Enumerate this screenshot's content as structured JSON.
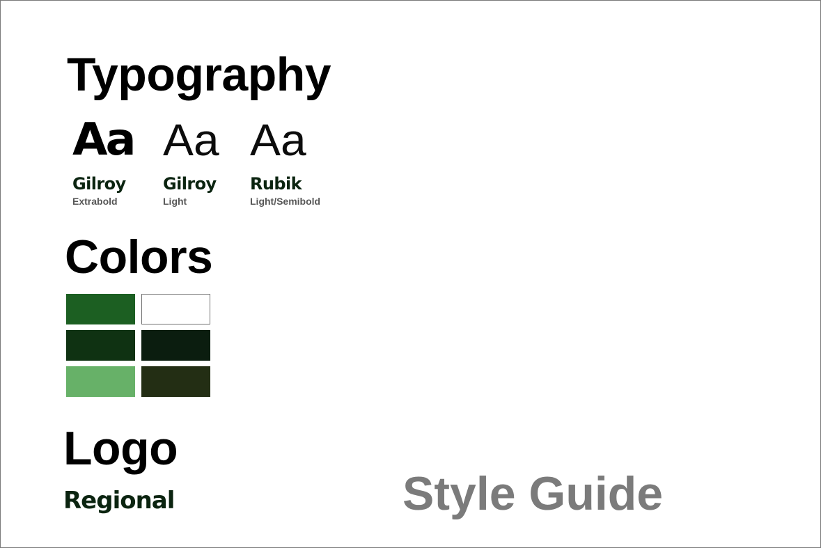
{
  "sections": {
    "typography": "Typography",
    "colors": "Colors",
    "logo": "Logo"
  },
  "typography": {
    "samples": [
      {
        "glyph": "Aa",
        "font": "Gilroy",
        "weight": "Extrabold"
      },
      {
        "glyph": "Aa",
        "font": "Gilroy",
        "weight": "Light"
      },
      {
        "glyph": "Aa",
        "font": "Rubik",
        "weight": "Light/Semibold"
      }
    ]
  },
  "colors": {
    "palette": [
      "#1c5f22",
      "#ffffff",
      "#0f3212",
      "#0b1d0f",
      "#67b168",
      "#232e14"
    ]
  },
  "logo": {
    "wordmark": "Regional"
  },
  "footer": {
    "title": "Style Guide"
  }
}
